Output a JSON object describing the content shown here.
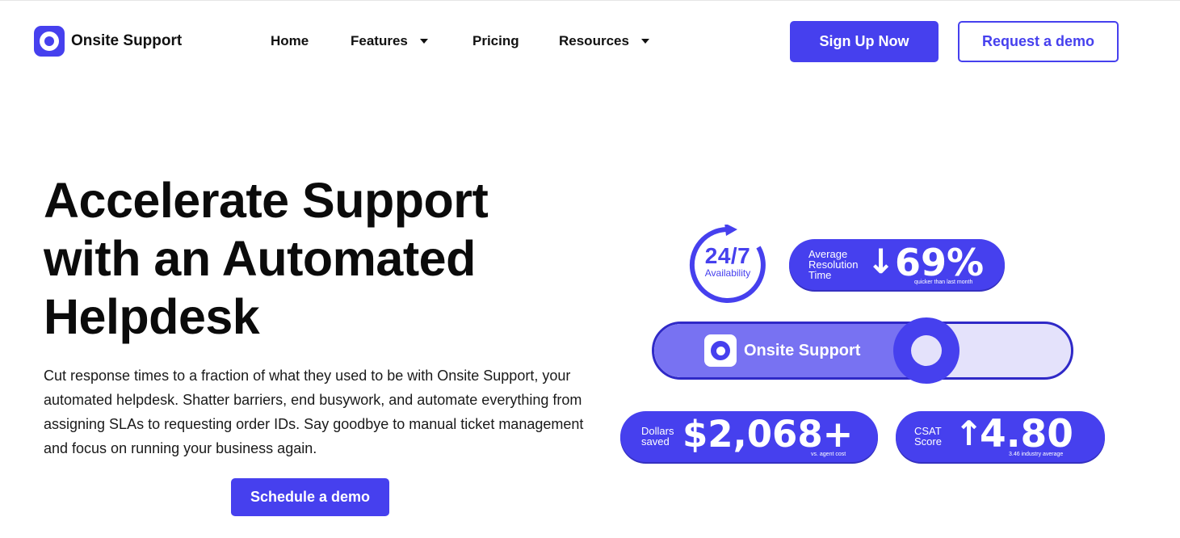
{
  "brand": {
    "name": "Onsite Support",
    "color": "#4640ee"
  },
  "nav": {
    "items": [
      {
        "label": "Home"
      },
      {
        "label": "Features"
      },
      {
        "label": "Pricing"
      },
      {
        "label": "Resources"
      }
    ],
    "signup_label": "Sign Up Now",
    "demo_label": "Request a demo"
  },
  "hero": {
    "title": "Accelerate Support with an Automated Helpdesk",
    "description": "Cut response times to a fraction of what they used to be with Onsite Support, your automated helpdesk. Shatter barriers, end busywork, and automate everything from assigning SLAs to requesting order IDs. Say goodbye to manual ticket management and focus on running your business again.",
    "cta_label": "Schedule a demo"
  },
  "stats": {
    "availability": {
      "value": "24/7",
      "label": "Availability"
    },
    "resolution": {
      "label_lines": [
        "Average",
        "Resolution",
        "Time"
      ],
      "arrow": "↓",
      "value": "69%",
      "note": "quicker than last month"
    },
    "toggle": {
      "label": "Onsite Support"
    },
    "dollars": {
      "label_lines": [
        "Dollars",
        "saved"
      ],
      "value": "$2,068+",
      "note": "vs. agent cost"
    },
    "csat": {
      "label_lines": [
        "CSAT",
        "Score"
      ],
      "arrow": "↑",
      "value": "4.80",
      "note": "3.46 industry average"
    }
  }
}
